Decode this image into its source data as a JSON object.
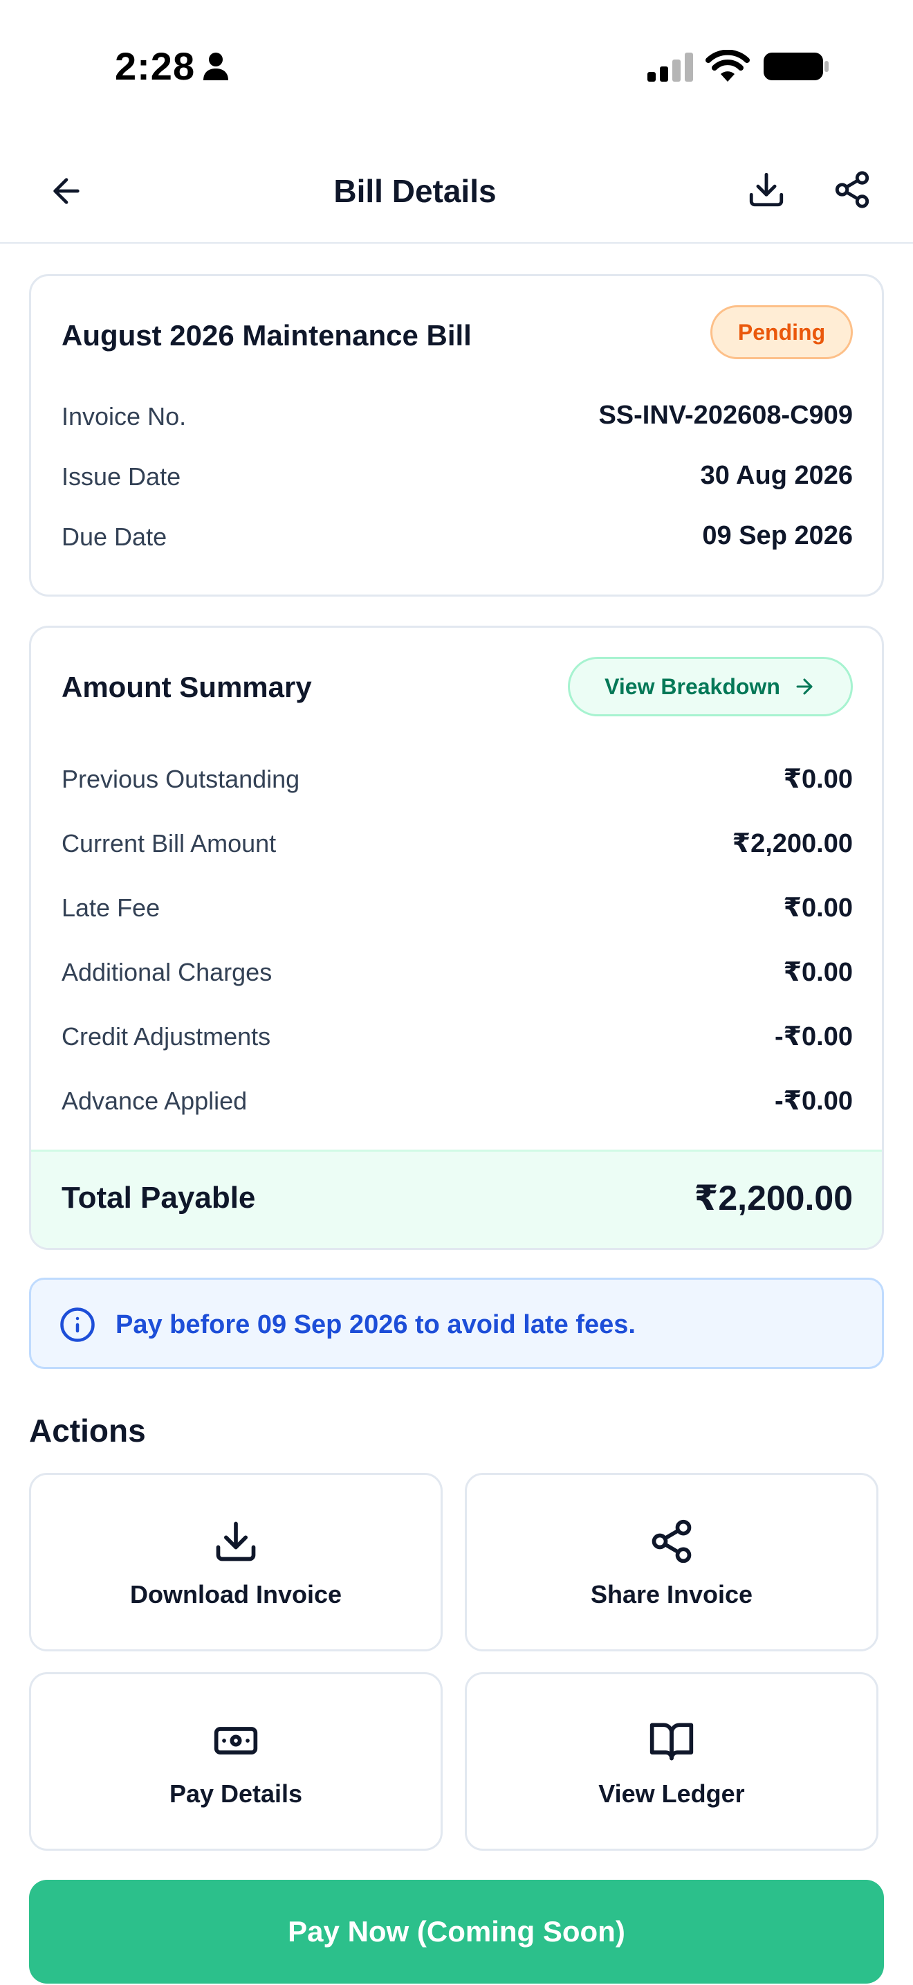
{
  "status_bar": {
    "time": "2:28"
  },
  "header": {
    "title": "Bill Details"
  },
  "bill_card": {
    "title": "August 2026 Maintenance Bill",
    "status": "Pending",
    "rows": [
      {
        "label": "Invoice No.",
        "value": "SS-INV-202608-C909"
      },
      {
        "label": "Issue Date",
        "value": "30 Aug 2026"
      },
      {
        "label": "Due Date",
        "value": "09 Sep 2026"
      }
    ]
  },
  "amount_summary": {
    "title": "Amount Summary",
    "breakdown_label": "View Breakdown",
    "rows": [
      {
        "label": "Previous Outstanding",
        "value": "₹0.00"
      },
      {
        "label": "Current Bill Amount",
        "value": "₹2,200.00"
      },
      {
        "label": "Late Fee",
        "value": "₹0.00"
      },
      {
        "label": "Additional Charges",
        "value": "₹0.00"
      },
      {
        "label": "Credit Adjustments",
        "value": "-₹0.00"
      },
      {
        "label": "Advance Applied",
        "value": "-₹0.00"
      }
    ],
    "total_label": "Total Payable",
    "total_value": "₹2,200.00"
  },
  "notice": {
    "text": "Pay before 09 Sep 2026 to avoid late fees."
  },
  "actions": {
    "title": "Actions",
    "items": [
      {
        "label": "Download Invoice",
        "icon": "download-icon"
      },
      {
        "label": "Share Invoice",
        "icon": "share-icon"
      },
      {
        "label": "Pay Details",
        "icon": "cash-icon"
      },
      {
        "label": "View Ledger",
        "icon": "book-icon"
      }
    ]
  },
  "pay_button": {
    "label": "Pay Now (Coming Soon)"
  },
  "colors": {
    "accent": "#2cc08b",
    "pending_text": "#ea580c",
    "pending_bg": "#ffedd5",
    "notice_text": "#1d4ed8",
    "notice_bg": "#eff6ff",
    "total_bg": "#ecfdf5"
  }
}
